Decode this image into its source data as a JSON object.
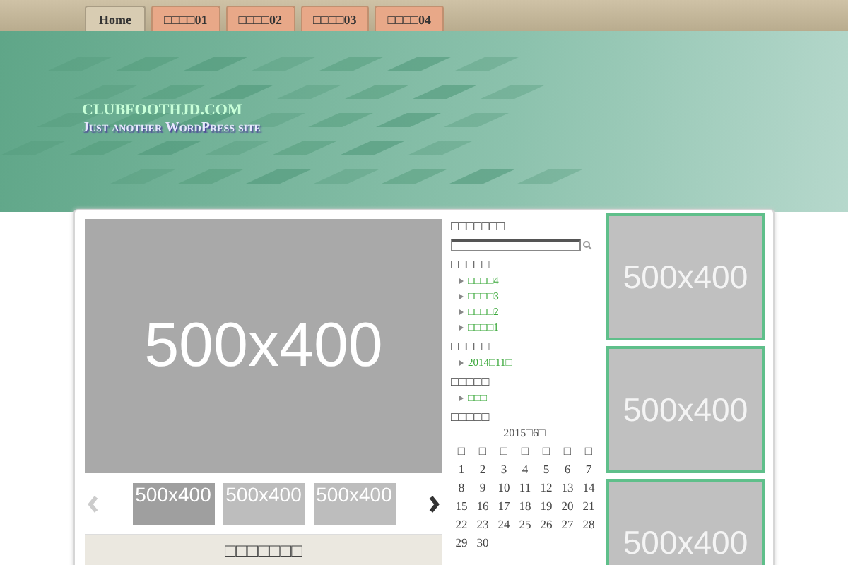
{
  "nav": {
    "tabs": [
      {
        "label": "Home",
        "selected": true
      },
      {
        "label": "□□□□01",
        "selected": false
      },
      {
        "label": "□□□□02",
        "selected": false
      },
      {
        "label": "□□□□03",
        "selected": false
      },
      {
        "label": "□□□□04",
        "selected": false
      }
    ]
  },
  "header": {
    "site_title": "CLUBFOOTHJD.COM",
    "tagline": "Just another WordPress site"
  },
  "slider": {
    "main_image": "500x400",
    "thumbnails": [
      {
        "label": "500x400",
        "selected": true
      },
      {
        "label": "500x400",
        "selected": false
      },
      {
        "label": "500x400",
        "selected": false
      }
    ]
  },
  "post_box": {
    "title": "□□□□□□□"
  },
  "sidebar": {
    "search": {
      "title": "□□□□□□□"
    },
    "widgets": [
      {
        "title": "□□□□□",
        "items": [
          "□□□□4",
          "□□□□3",
          "□□□□2",
          "□□□□1"
        ]
      },
      {
        "title": "□□□□□",
        "items": [
          "2014□11□"
        ]
      },
      {
        "title": "□□□□□",
        "items": [
          "□□□"
        ]
      }
    ],
    "calendar": {
      "title": "□□□□□",
      "caption": "2015□6□",
      "weekdays": [
        "□",
        "□",
        "□",
        "□",
        "□",
        "□",
        "□"
      ],
      "weeks": [
        [
          "1",
          "2",
          "3",
          "4",
          "5",
          "6",
          "7"
        ],
        [
          "8",
          "9",
          "10",
          "11",
          "12",
          "13",
          "14"
        ],
        [
          "15",
          "16",
          "17",
          "18",
          "19",
          "20",
          "21"
        ],
        [
          "22",
          "23",
          "24",
          "25",
          "26",
          "27",
          "28"
        ],
        [
          "29",
          "30"
        ]
      ]
    }
  },
  "ads": [
    "500x400",
    "500x400",
    "500x400"
  ]
}
